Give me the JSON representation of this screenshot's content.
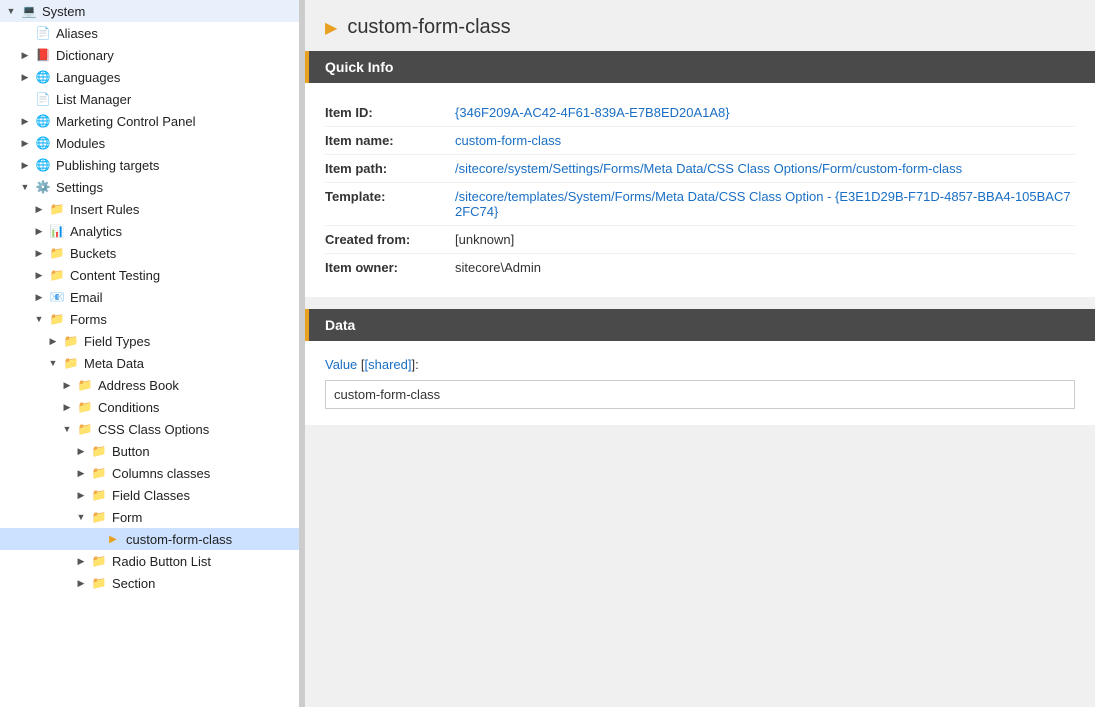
{
  "header": {
    "title": "custom-form-class",
    "arrow": "▶"
  },
  "sidebar": {
    "items": [
      {
        "id": "system",
        "label": "System",
        "indent": 0,
        "arrow": "open",
        "icon": "💻",
        "iconClass": "icon-system"
      },
      {
        "id": "aliases",
        "label": "Aliases",
        "indent": 1,
        "arrow": "leaf",
        "icon": "📄",
        "iconClass": "icon-page"
      },
      {
        "id": "dictionary",
        "label": "Dictionary",
        "indent": 1,
        "arrow": "closed",
        "icon": "📕",
        "iconClass": "icon-folder"
      },
      {
        "id": "languages",
        "label": "Languages",
        "indent": 1,
        "arrow": "closed",
        "icon": "🌐",
        "iconClass": "icon-globe"
      },
      {
        "id": "list-manager",
        "label": "List Manager",
        "indent": 1,
        "arrow": "leaf",
        "icon": "📄",
        "iconClass": "icon-page"
      },
      {
        "id": "marketing-control-panel",
        "label": "Marketing Control Panel",
        "indent": 1,
        "arrow": "closed",
        "icon": "🌐",
        "iconClass": "icon-globe"
      },
      {
        "id": "modules",
        "label": "Modules",
        "indent": 1,
        "arrow": "closed",
        "icon": "🌐",
        "iconClass": "icon-globe"
      },
      {
        "id": "publishing-targets",
        "label": "Publishing targets",
        "indent": 1,
        "arrow": "closed",
        "icon": "🌐",
        "iconClass": "icon-globe"
      },
      {
        "id": "settings",
        "label": "Settings",
        "indent": 1,
        "arrow": "open",
        "icon": "⚙️",
        "iconClass": "icon-settings"
      },
      {
        "id": "insert-rules",
        "label": "Insert Rules",
        "indent": 2,
        "arrow": "closed",
        "icon": "📁",
        "iconClass": "icon-folder"
      },
      {
        "id": "analytics",
        "label": "Analytics",
        "indent": 2,
        "arrow": "closed",
        "icon": "📊",
        "iconClass": "icon-analytics"
      },
      {
        "id": "buckets",
        "label": "Buckets",
        "indent": 2,
        "arrow": "closed",
        "icon": "📁",
        "iconClass": "icon-folder"
      },
      {
        "id": "content-testing",
        "label": "Content Testing",
        "indent": 2,
        "arrow": "closed",
        "icon": "📁",
        "iconClass": "icon-folder"
      },
      {
        "id": "email",
        "label": "Email",
        "indent": 2,
        "arrow": "closed",
        "icon": "📧",
        "iconClass": "icon-email"
      },
      {
        "id": "forms",
        "label": "Forms",
        "indent": 2,
        "arrow": "open",
        "icon": "📁",
        "iconClass": "icon-folder"
      },
      {
        "id": "field-types",
        "label": "Field Types",
        "indent": 3,
        "arrow": "closed",
        "icon": "📁",
        "iconClass": "icon-folder"
      },
      {
        "id": "meta-data",
        "label": "Meta Data",
        "indent": 3,
        "arrow": "open",
        "icon": "📁",
        "iconClass": "icon-folder"
      },
      {
        "id": "address-book",
        "label": "Address Book",
        "indent": 4,
        "arrow": "closed",
        "icon": "📁",
        "iconClass": "icon-folder"
      },
      {
        "id": "conditions",
        "label": "Conditions",
        "indent": 4,
        "arrow": "closed",
        "icon": "📁",
        "iconClass": "icon-folder"
      },
      {
        "id": "css-class-options",
        "label": "CSS Class Options",
        "indent": 4,
        "arrow": "open",
        "icon": "📁",
        "iconClass": "icon-folder"
      },
      {
        "id": "button",
        "label": "Button",
        "indent": 5,
        "arrow": "closed",
        "icon": "📁",
        "iconClass": "icon-folder"
      },
      {
        "id": "columns-classes",
        "label": "Columns classes",
        "indent": 5,
        "arrow": "closed",
        "icon": "📁",
        "iconClass": "icon-folder"
      },
      {
        "id": "field-classes",
        "label": "Field Classes",
        "indent": 5,
        "arrow": "closed",
        "icon": "📁",
        "iconClass": "icon-folder"
      },
      {
        "id": "form",
        "label": "Form",
        "indent": 5,
        "arrow": "open",
        "icon": "📁",
        "iconClass": "icon-folder"
      },
      {
        "id": "custom-form-class",
        "label": "custom-form-class",
        "indent": 6,
        "arrow": "leaf",
        "icon": "▶",
        "iconClass": "icon-arrow",
        "selected": true
      },
      {
        "id": "radio-button-list",
        "label": "Radio Button List",
        "indent": 5,
        "arrow": "closed",
        "icon": "📁",
        "iconClass": "icon-folder"
      },
      {
        "id": "section",
        "label": "Section",
        "indent": 5,
        "arrow": "closed",
        "icon": "📁",
        "iconClass": "icon-folder"
      }
    ]
  },
  "quickinfo": {
    "section_title": "Quick Info",
    "rows": [
      {
        "label": "Item ID:",
        "value": "{346F209A-AC42-4F61-839A-E7B8ED20A1A8}",
        "style": "link"
      },
      {
        "label": "Item name:",
        "value": "custom-form-class",
        "style": "link"
      },
      {
        "label": "Item path:",
        "value": "/sitecore/system/Settings/Forms/Meta Data/CSS Class Options/Form/custom-form-class",
        "style": "link"
      },
      {
        "label": "Template:",
        "value": "/sitecore/templates/System/Forms/Meta Data/CSS Class Option - {E3E1D29B-F71D-4857-BBA4-105BAC72FC74}",
        "style": "link"
      },
      {
        "label": "Created from:",
        "value": "[unknown]",
        "style": "plain"
      },
      {
        "label": "Item owner:",
        "value": "sitecore\\Admin",
        "style": "plain"
      }
    ]
  },
  "data": {
    "section_title": "Data",
    "value_label": "Value",
    "value_shared": "[shared]",
    "value_content": "custom-form-class"
  }
}
